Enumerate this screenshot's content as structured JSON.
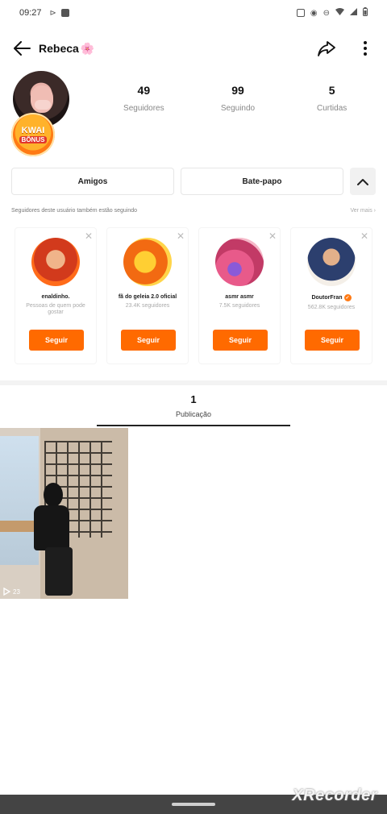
{
  "status_bar": {
    "time": "09:27",
    "left_icons": [
      "nfc-icon",
      "camera-record-icon"
    ],
    "right_icons": [
      "cast-icon",
      "eye-icon",
      "do-not-disturb-icon",
      "wifi-icon",
      "signal-icon",
      "battery-icon"
    ]
  },
  "header": {
    "username": "Rebeca",
    "username_emoji": "🌸"
  },
  "profile": {
    "badge": {
      "line1": "KWAI",
      "line2": "BÔNUS"
    },
    "stats": [
      {
        "value": "49",
        "label": "Seguidores"
      },
      {
        "value": "99",
        "label": "Seguindo"
      },
      {
        "value": "5",
        "label": "Curtidas"
      }
    ]
  },
  "actions": {
    "friends_label": "Amigos",
    "chat_label": "Bate-papo"
  },
  "suggestions": {
    "title": "Seguidores deste usuário também estão seguindo",
    "see_more": "Ver mais",
    "cards": [
      {
        "name": "enaldinho.",
        "sub": "Pessoas de quem pode gostar",
        "follow": "Seguir",
        "verified": false
      },
      {
        "name": "fã do geleia 2.0 oficial",
        "sub": "23.4K seguidores",
        "follow": "Seguir",
        "verified": false
      },
      {
        "name": "asmr asmr",
        "sub": "7.5K seguidores",
        "follow": "Seguir",
        "verified": false
      },
      {
        "name": "DoutorFran",
        "sub": "562.8K seguidores",
        "follow": "Seguir",
        "verified": true
      }
    ]
  },
  "tabs": {
    "count": "1",
    "label": "Publicação"
  },
  "posts": [
    {
      "views": "23"
    }
  ],
  "watermark": "XRecorder",
  "colors": {
    "accent": "#ff6a00",
    "badge": "#ffb22b"
  }
}
